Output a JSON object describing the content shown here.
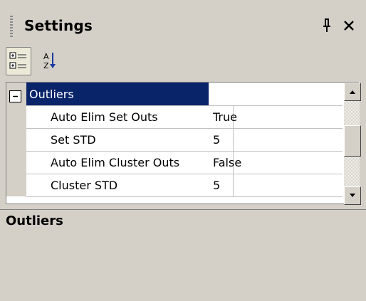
{
  "panel": {
    "title": "Settings",
    "icons": {
      "pin": "pin-icon",
      "close": "close-icon",
      "grip": "grip-icon"
    }
  },
  "toolbar": {
    "buttons": [
      {
        "icon": "categorized-icon",
        "pressed": true
      },
      {
        "icon": "sort-alphabetical-icon",
        "pressed": false
      }
    ]
  },
  "grid": {
    "category": {
      "label": "Outliers",
      "expanded": true
    },
    "properties": [
      {
        "name": "Auto Elim Set Outs",
        "value": "True"
      },
      {
        "name": "Set STD",
        "value": "5"
      },
      {
        "name": "Auto Elim Cluster Outs",
        "value": "False"
      },
      {
        "name": "Cluster STD",
        "value": "5"
      }
    ]
  },
  "description": {
    "title": "Outliers"
  },
  "colors": {
    "panel_bg": "#d4d0c8",
    "selection_bg": "#0a246a",
    "grid_line": "#c0c0c0"
  }
}
